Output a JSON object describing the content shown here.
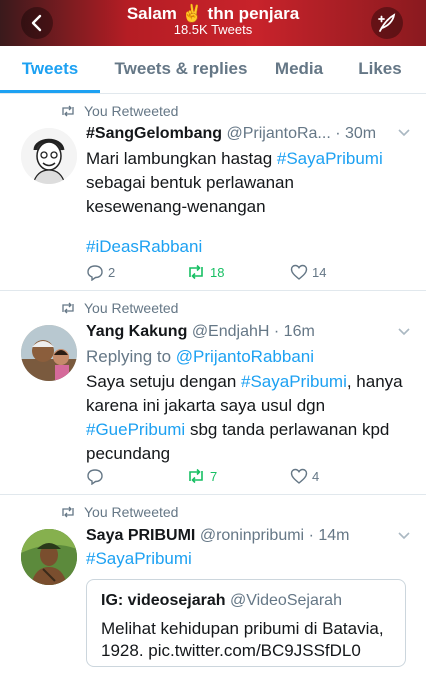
{
  "header": {
    "title": "Salam ✌️ thn penjara",
    "subtitle": "18.5K Tweets"
  },
  "tabs": [
    {
      "label": "Tweets",
      "active": true
    },
    {
      "label": "Tweets & replies",
      "active": false
    },
    {
      "label": "Media",
      "active": false
    },
    {
      "label": "Likes",
      "active": false
    }
  ],
  "colors": {
    "accent": "#1da1f2",
    "retweet": "#17bf63",
    "muted": "#657786"
  },
  "tweets": [
    {
      "retweet_label": "You Retweeted",
      "name": "#SangGelombang",
      "handle": "@PrijantoRa...",
      "time": "· 30m",
      "text_1": "Mari lambungkan hastag ",
      "tag_1": "#SayaPribumi",
      "text_2": "sebagai bentuk perlawanan",
      "text_3": "kesewenang-wenangan",
      "tag_2": "#iDeasRabbani",
      "reply_count": "2",
      "retweet_count": "18",
      "like_count": "14"
    },
    {
      "retweet_label": "You Retweeted",
      "name": "Yang Kakung",
      "handle": "@EndjahH",
      "time": "· 16m",
      "reply_prefix": "Replying to ",
      "reply_to": "@PrijantoRabbani",
      "text_1": "Saya setuju dengan ",
      "tag_1": "#SayaPribumi",
      "text_1b": ", hanya",
      "text_2": "karena ini jakarta saya usul dgn",
      "tag_2": "#GuePribumi",
      "text_3": " sbg tanda perlawanan kpd",
      "text_4": "pecundang",
      "reply_count": "",
      "retweet_count": "7",
      "like_count": "4"
    },
    {
      "retweet_label": "You Retweeted",
      "name": "Saya PRIBUMI",
      "handle": "@roninpribumi",
      "time": "· 14m",
      "tag_1": "#SayaPribumi",
      "quote": {
        "name": "IG: videosejarah",
        "handle": "@VideoSejarah",
        "text_1": "Melihat kehidupan pribumi di Batavia,",
        "text_2": "1928. pic.twitter.com/BC9JSSfDL0"
      }
    }
  ]
}
